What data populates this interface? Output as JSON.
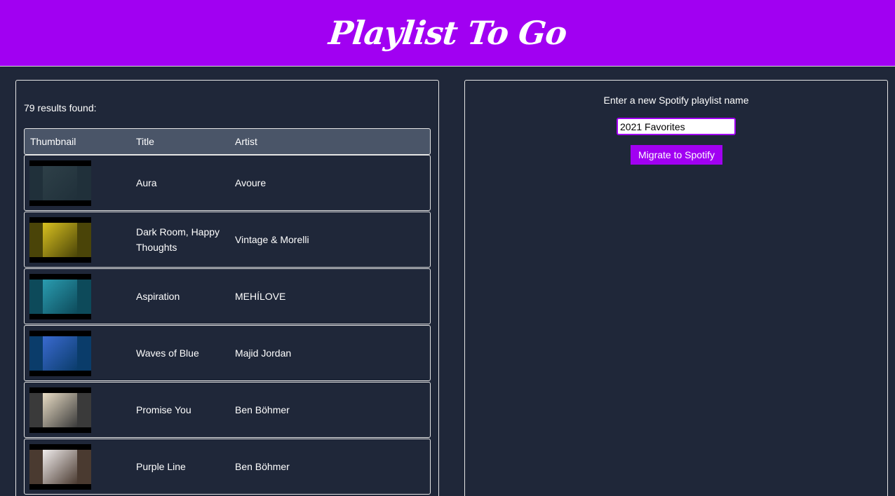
{
  "header": {
    "logo_text": "Playlist To Go"
  },
  "results": {
    "count_text": "79 results found:",
    "columns": [
      "Thumbnail",
      "Title",
      "Artist"
    ],
    "rows": [
      {
        "title": "Aura",
        "artist": "Avoure",
        "thumb_colors": [
          "#20303a",
          "#2e4048"
        ]
      },
      {
        "title": "Dark Room, Happy Thoughts",
        "artist": "Vintage & Morelli",
        "thumb_colors": [
          "#4a4408",
          "#d8c020"
        ]
      },
      {
        "title": "Aspiration",
        "artist": "MEHÍLOVE",
        "thumb_colors": [
          "#0d4a5a",
          "#2a9cb0"
        ]
      },
      {
        "title": "Waves of Blue",
        "artist": "Majid Jordan",
        "thumb_colors": [
          "#0a3c6a",
          "#3a6ad0"
        ]
      },
      {
        "title": "Promise You",
        "artist": "Ben Böhmer",
        "thumb_colors": [
          "#3a3a3a",
          "#e8dcc4"
        ]
      },
      {
        "title": "Purple Line",
        "artist": "Ben Böhmer",
        "thumb_colors": [
          "#4a3a30",
          "#f0ecec"
        ]
      }
    ]
  },
  "migrate": {
    "prompt": "Enter a new Spotify playlist name",
    "input_value": "2021 Favorites",
    "button_label": "Migrate to Spotify"
  },
  "colors": {
    "brand": "#a100f2",
    "background": "#1f2739",
    "table_header": "#4a5568"
  }
}
